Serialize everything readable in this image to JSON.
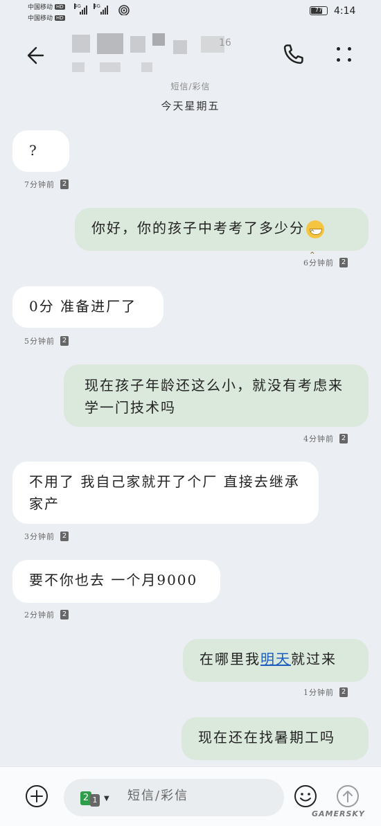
{
  "status_bar": {
    "carrier_1": "中国移动",
    "carrier_2": "中国移动",
    "hd_label": "HD",
    "network": "4G",
    "battery_level": "77",
    "time": "4:14"
  },
  "header": {
    "contact_name_digits": "16"
  },
  "channel_label": "短信/彩信",
  "date_header": "今天星期五",
  "messages": [
    {
      "direction": "incoming",
      "text": "?",
      "time": "7分钟前",
      "sim": "2"
    },
    {
      "direction": "outgoing",
      "text": "你好，你的孩子中考考了多少分",
      "emoji": "grinning-face",
      "time": "6分钟前",
      "sim": "2"
    },
    {
      "direction": "incoming",
      "text": "0分  准备进厂了",
      "time": "5分钟前",
      "sim": "2"
    },
    {
      "direction": "outgoing",
      "text": "现在孩子年龄还这么小，就没有考虑来学一门技术吗",
      "time": "4分钟前",
      "sim": "2"
    },
    {
      "direction": "incoming",
      "text": "不用了  我自己家就开了个厂  直接去继承家产",
      "time": "3分钟前",
      "sim": "2"
    },
    {
      "direction": "incoming",
      "text": "要不你也去  一个月9000",
      "time": "2分钟前",
      "sim": "2"
    },
    {
      "direction": "outgoing",
      "text_before": "在哪里我",
      "text_link": "明天",
      "text_after": "就过来",
      "time": "1分钟前",
      "sim": "2"
    },
    {
      "direction": "outgoing",
      "text": "现在还在找暑期工吗"
    }
  ],
  "composer": {
    "sim_primary": "2",
    "sim_secondary": "1",
    "placeholder": "短信/彩信"
  },
  "watermark": "GAMERSKY",
  "colors": {
    "background": "#ebeef2",
    "incoming_bubble": "#ffffff",
    "outgoing_bubble": "#dbe8dc",
    "link": "#1a5dbf",
    "sim_active": "#2e9e4a"
  },
  "icons": [
    "back-arrow-icon",
    "phone-icon",
    "more-icon",
    "plus-icon",
    "emoji-icon",
    "send-icon",
    "grinning-face-emoji"
  ]
}
